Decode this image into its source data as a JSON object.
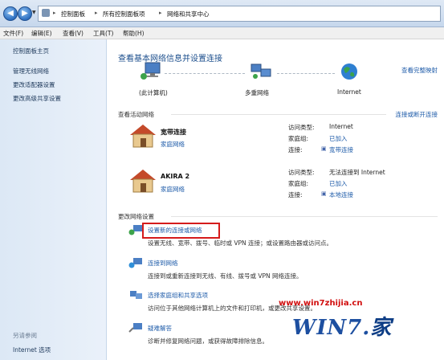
{
  "address": {
    "crumbs": [
      "控制面板",
      "所有控制面板项",
      "网络和共享中心"
    ],
    "separator": "▸"
  },
  "menu": [
    "文件(F)",
    "编辑(E)",
    "查看(V)",
    "工具(T)",
    "帮助(H)"
  ],
  "sidebar": {
    "items": [
      "控制面板主页",
      "管理无线网络",
      "更改适配器设置",
      "更改高级共享设置"
    ],
    "see_also": "另请参阅",
    "internet_options": "Internet 选项"
  },
  "main": {
    "title": "查看基本网络信息并设置连接",
    "full_map": "查看完整映射",
    "map": {
      "pc": "(此计算机)",
      "network": "多重网络",
      "internet": "Internet"
    },
    "active_label": "查看活动网络",
    "connect_disconnect": "连接或断开连接",
    "networks": [
      {
        "name": "宽带连接",
        "type": "家庭网络",
        "access_key": "访问类型:",
        "access_val": "Internet",
        "homegroup_key": "家庭组:",
        "homegroup_val": "已加入",
        "conn_key": "连接:",
        "conn_val": "宽带连接"
      },
      {
        "name": "AKIRA 2",
        "type": "家庭网络",
        "access_key": "访问类型:",
        "access_val": "无法连接到 Internet",
        "homegroup_key": "家庭组:",
        "homegroup_val": "已加入",
        "conn_key": "连接:",
        "conn_val": "本地连接"
      }
    ],
    "change_label": "更改网络设置",
    "tasks": [
      {
        "link": "设置新的连接或网络",
        "desc": "设置无线、宽带、拨号、临时或 VPN 连接；或设置路由器或访问点。"
      },
      {
        "link": "连接到网络",
        "desc": "连接到或重新连接到无线、有线、拨号或 VPN 网络连接。"
      },
      {
        "link": "选择家庭组和共享选项",
        "desc": "访问位于其他网络计算机上的文件和打印机，或更改共享设置。"
      },
      {
        "link": "疑难解答",
        "desc": "诊断并修复网络问题，或获得故障排除信息。"
      }
    ]
  },
  "watermark": {
    "url": "www.win7zhijia.cn",
    "logo_text": "WIN7.",
    "logo_suffix": "家"
  },
  "colors": {
    "link": "#1c5aa8",
    "title": "#1b4e8c",
    "highlight": "#d51b1b"
  }
}
